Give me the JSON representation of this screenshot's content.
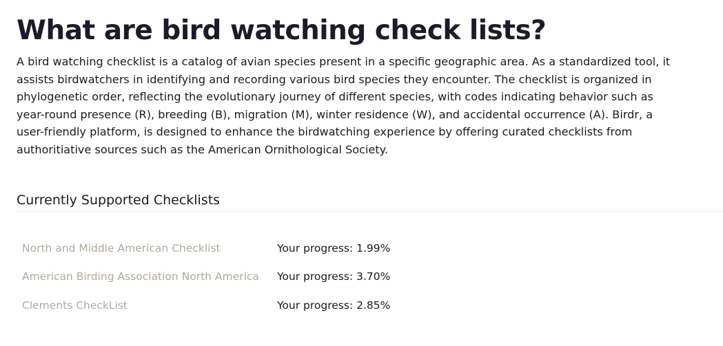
{
  "page_title": "What are bird watching check lists?",
  "intro": "A bird watching checklist is a catalog of avian species present in a specific geographic area. As a standardized tool, it assists birdwatchers in identifying and recording various bird species they encounter. The checklist is organized in phylogenetic order, reflecting the evolutionary journey of different species, with codes indicating behavior such as year-round presence (R), breeding (B), migration (M), winter residence (W), and accidental occurrence (A). Birdr, a user-friendly platform, is designed to enhance the birdwatching experience by offering curated checklists from authoritiative sources such as the American Ornithological Society.",
  "section": {
    "title": "Currently Supported Checklists"
  },
  "checklists": [
    {
      "name": "North and Middle American Checklist",
      "progress": "Your progress: 1.99%"
    },
    {
      "name": "American Birding Association North America",
      "progress": "Your progress: 3.70%"
    },
    {
      "name": "Clements CheckList",
      "progress": "Your progress: 2.85%"
    }
  ],
  "colors": {
    "link": "#b2a89e",
    "text": "#1a1a1a",
    "heading": "#1c1b2b",
    "divider": "#f0f0f0"
  }
}
